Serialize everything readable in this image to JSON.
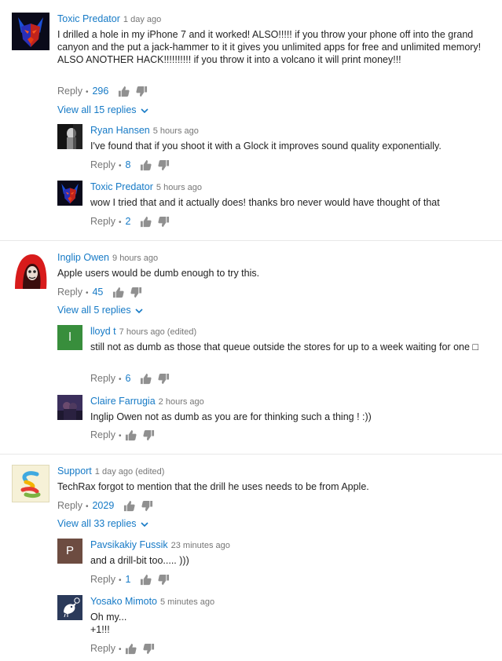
{
  "labels": {
    "reply": "Reply",
    "dot": "•"
  },
  "colors": {
    "link": "#167ac6",
    "meta": "#767676",
    "text": "#222222"
  },
  "threads": [
    {
      "comment": {
        "author": "Toxic Predator",
        "time": "1 day ago",
        "avatar": "wolf-avatar",
        "text": "I drilled a hole in my iPhone 7 and it worked! ALSO!!!!! if you throw your phone off into the grand canyon and the put a jack-hammer to it it gives you unlimited apps for free and unlimited memory! ALSO ANOTHER HACK!!!!!!!!!! if you throw it into a volcano it will print money!!!",
        "likes": "296"
      },
      "view_replies": "View all 15 replies",
      "replies": [
        {
          "author": "Ryan Hansen",
          "time": "5 hours ago",
          "avatar": "dark-portrait-avatar",
          "text": "I've found that if you shoot it with a Glock it improves sound quality exponentially.",
          "likes": "8"
        },
        {
          "author": "Toxic Predator",
          "time": "5 hours ago",
          "avatar": "wolf-avatar",
          "text": "wow I tried that and it actually does! thanks bro never would have thought of that",
          "likes": "2"
        }
      ]
    },
    {
      "comment": {
        "author": "Inglip Owen",
        "time": "9 hours ago",
        "avatar": "red-hood-avatar",
        "text": "Apple users would be dumb enough to try this.",
        "likes": "45"
      },
      "view_replies": "View all 5 replies",
      "replies": [
        {
          "author": "lloyd t",
          "time": "7 hours ago (edited)",
          "avatar": "letter-avatar",
          "avatar_letter": "l",
          "avatar_color": "#388e3c",
          "text": "still not as dumb as those that queue outside the stores for up to a week waiting for one □",
          "likes": "6"
        },
        {
          "author": "Claire Farrugia",
          "time": "2 hours ago",
          "avatar": "couple-photo-avatar",
          "text": "Inglip Owen not as dumb as you are for thinking such a thing ! :))",
          "likes": ""
        }
      ]
    },
    {
      "comment": {
        "author": "Support",
        "time": "1 day ago (edited)",
        "avatar": "colorful-logo-avatar",
        "text": "TechRax forgot to mention that the drill he uses needs to be from Apple.",
        "likes": "2029"
      },
      "view_replies": "View all 33 replies",
      "replies": [
        {
          "author": "Pavsikakiy Fussik",
          "time": "23 minutes ago",
          "avatar": "letter-avatar",
          "avatar_letter": "P",
          "avatar_color": "#6d4c41",
          "text": "and a drill-bit too..... )))",
          "likes": "1"
        },
        {
          "author": "Yosako Mimoto",
          "time": "5 minutes ago",
          "avatar": "bird-avatar",
          "text": "Oh my...\n+1!!!",
          "likes": ""
        }
      ]
    }
  ]
}
